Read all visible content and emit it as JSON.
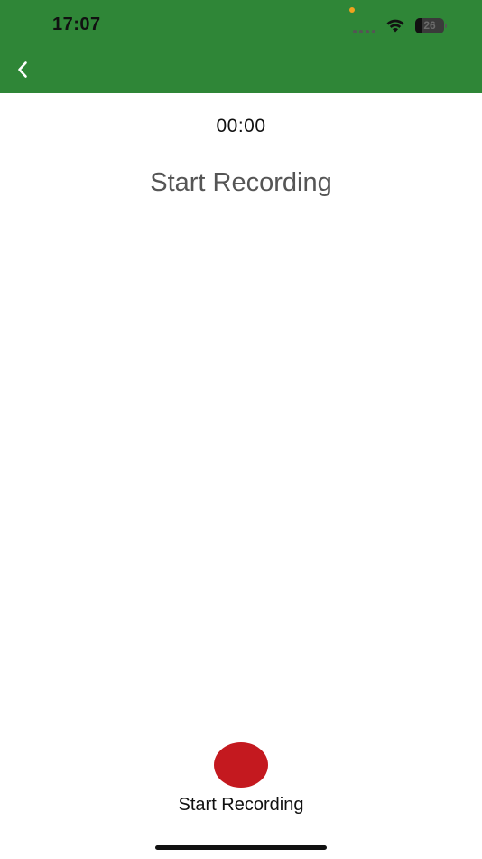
{
  "status_bar": {
    "time": "17:07",
    "battery_level": "26",
    "battery_fraction": 0.26,
    "icons": [
      "privacy-dot",
      "signal-icon",
      "wifi-icon",
      "battery-icon"
    ]
  },
  "header": {
    "back_icon": "chevron-left-icon",
    "color": "#2f8637"
  },
  "main": {
    "timer": "00:00",
    "title": "Start Recording"
  },
  "recorder": {
    "button_icon": "record-icon",
    "button_color": "#c4191f",
    "label": "Start Recording"
  }
}
